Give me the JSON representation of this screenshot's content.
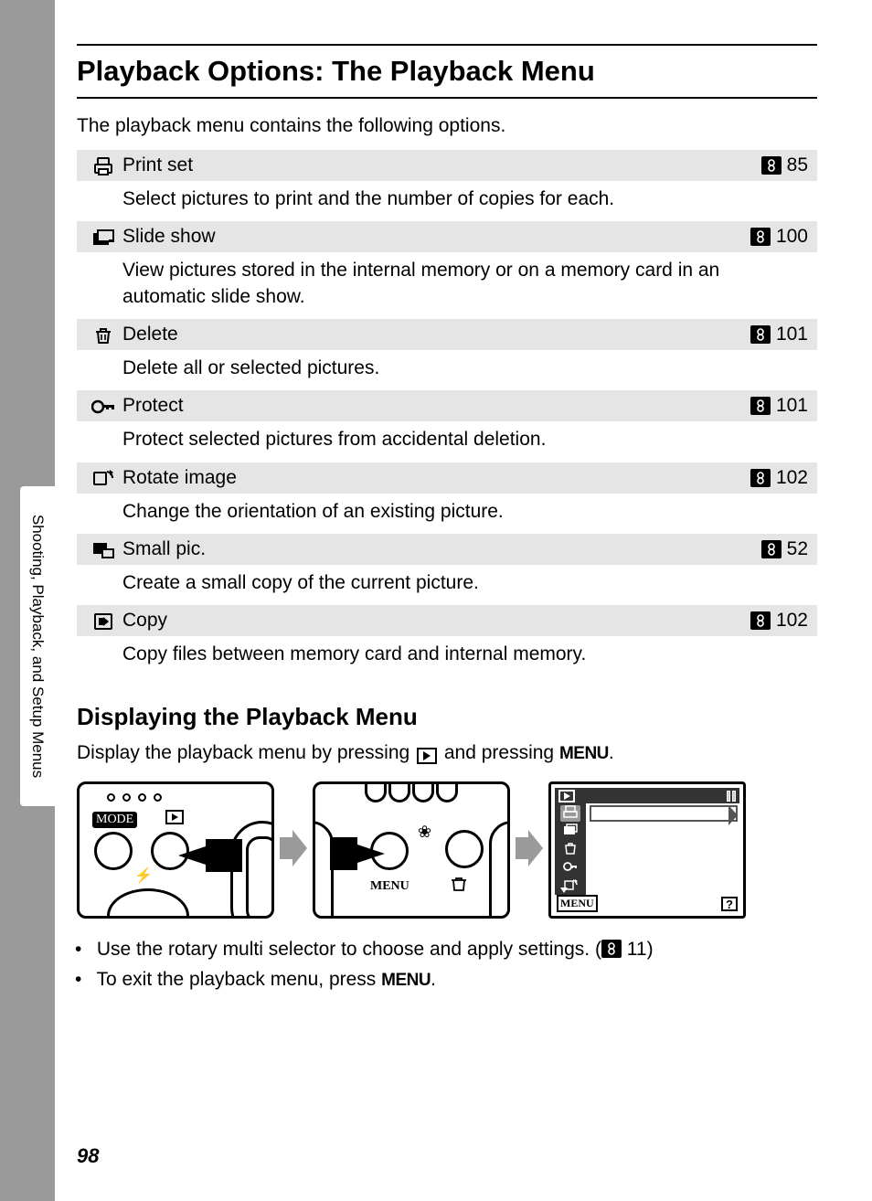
{
  "side_tab": "Shooting, Playback, and Setup Menus",
  "title": "Playback Options: The Playback Menu",
  "intro": "The playback menu contains the following options.",
  "options": [
    {
      "icon_name": "print-set-icon",
      "name": "Print set",
      "page": "85",
      "desc": "Select pictures to print and the number of copies for each."
    },
    {
      "icon_name": "slide-show-icon",
      "name": "Slide show",
      "page": "100",
      "desc": "View pictures stored in the internal memory or on a memory card in an automatic slide show."
    },
    {
      "icon_name": "delete-icon",
      "name": "Delete",
      "page": "101",
      "desc": "Delete all or selected pictures."
    },
    {
      "icon_name": "protect-icon",
      "name": "Protect",
      "page": "101",
      "desc": "Protect selected pictures from accidental deletion."
    },
    {
      "icon_name": "rotate-image-icon",
      "name": "Rotate image",
      "page": "102",
      "desc": "Change the orientation of an existing picture."
    },
    {
      "icon_name": "small-pic-icon",
      "name": "Small pic.",
      "page": "52",
      "desc": "Create a small copy of the current picture."
    },
    {
      "icon_name": "copy-icon",
      "name": "Copy",
      "page": "102",
      "desc": "Copy files between memory card and internal memory."
    }
  ],
  "subhead": "Displaying the Playback Menu",
  "instruct_pre": "Display the playback menu by pressing ",
  "instruct_mid": " and pressing ",
  "menu_word": "MENU",
  "instruct_post": ".",
  "diagram": {
    "d1_mode": "MODE",
    "d2_menu": "MENU",
    "d3_menu": "MENU",
    "d3_help": "?"
  },
  "notes": {
    "n1_pre": "Use the rotary multi selector to choose and apply settings. (",
    "n1_page": "11",
    "n1_post": ")",
    "n2_pre": "To exit the playback menu, press ",
    "n2_post": "."
  },
  "page_number": "98"
}
